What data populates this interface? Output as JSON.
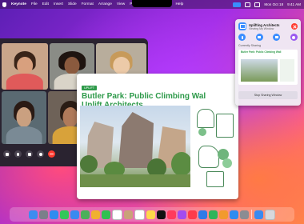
{
  "menubar": {
    "app_name": "Keynote",
    "items": [
      "File",
      "Edit",
      "Insert",
      "Slide",
      "Format",
      "Arrange",
      "View",
      "Play",
      "Share",
      "Window",
      "Help"
    ],
    "clock": "Mon Oct 18",
    "time": "9:41 AM"
  },
  "sharing_panel": {
    "title": "Uplifting Architects",
    "subtitle": "Viewing My Window",
    "section_label": "Currently Sharing",
    "thumb_title": "Butler Park: Public Climbing Wall",
    "stop_button": "Stop Sharing Window"
  },
  "document": {
    "tag": "UPLIFT",
    "title_line1": "Butler Park: Public Climbing Wal",
    "title_line2": "Uplift Architects"
  },
  "dock": {
    "icons": [
      "finder-icon",
      "launchpad-icon",
      "safari-icon",
      "messages-icon",
      "mail-icon",
      "maps-icon",
      "photos-icon",
      "facetime-icon",
      "calendar-icon",
      "contacts-icon",
      "reminders-icon",
      "notes-icon",
      "tv-icon",
      "music-icon",
      "podcasts-icon",
      "news-icon",
      "keynote-icon",
      "numbers-icon",
      "pages-icon",
      "appstore-icon",
      "settings-icon",
      "downloads-icon",
      "trash-icon"
    ],
    "colors": [
      "#3d8cf0",
      "#7a7f8a",
      "#2f8cf0",
      "#32c759",
      "#3a8af0",
      "#4cb05a",
      "#f0b030",
      "#30c050",
      "#ffffff",
      "#c9a27a",
      "#ffffff",
      "#ffd84a",
      "#111111",
      "#ff3b5c",
      "#a34cf0",
      "#ff3b4a",
      "#2f7ae8",
      "#2fb45a",
      "#f29a2e",
      "#2f8cf0",
      "#8c8c92",
      "#3a8af0",
      "#d8d8dc"
    ]
  }
}
